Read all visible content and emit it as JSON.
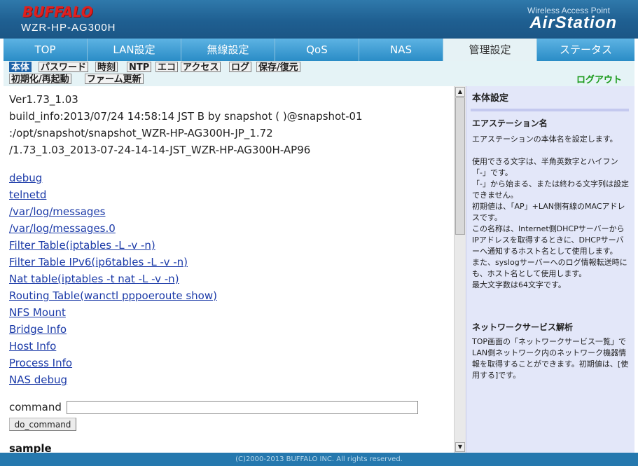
{
  "header": {
    "brand": "BUFFALO",
    "model": "WZR-HP-AG300H",
    "product_sub": "Wireless Access Point",
    "product": "AirStation"
  },
  "tabs": [
    {
      "label": "TOP"
    },
    {
      "label": "LAN設定"
    },
    {
      "label": "無線設定"
    },
    {
      "label": "QoS"
    },
    {
      "label": "NAS"
    },
    {
      "label": "管理設定"
    },
    {
      "label": "ステータス"
    }
  ],
  "active_tab": "管理設定",
  "subtabs": [
    {
      "label": "本体"
    },
    {
      "label": "パスワード"
    },
    {
      "label": "時刻"
    },
    {
      "label": "NTP"
    },
    {
      "label": "エコ"
    },
    {
      "label": "アクセス"
    },
    {
      "label": "ログ"
    },
    {
      "label": "保存/復元"
    },
    {
      "label": "初期化/再起動"
    },
    {
      "label": "ファーム更新"
    }
  ],
  "active_subtab": "本体",
  "logout": "ログアウト",
  "content": {
    "version_lines": [
      "Ver1.73_1.03",
      "build_info:2013/07/24 14:58:14 JST B by snapshot ( )@snapshot-01",
      ":/opt/snapshot/snapshot_WZR-HP-AG300H-JP_1.72",
      "/1.73_1.03_2013-07-24-14-14-JST_WZR-HP-AG300H-AP96"
    ],
    "links": [
      "debug",
      "telnetd",
      "/var/log/messages",
      "/var/log/messages.0",
      "Filter Table(iptables -L -v -n)",
      "Filter Table IPv6(ip6tables -L -v -n)",
      "Nat table(iptables -t nat -L -v -n)",
      "Routing Table(wanctl pppoeroute show)",
      "NFS Mount",
      "Bridge Info",
      "Host Info",
      "Process Info",
      "NAS debug"
    ],
    "command_label": "command",
    "command_value": "",
    "do_command_label": "do_command",
    "sample_heading": "sample"
  },
  "help": {
    "title": "本体設定",
    "section1_title": "エアステーション名",
    "section1_p1": "エアステーションの本体名を設定します。",
    "section1_p2": "使用できる文字は、半角英数字とハイフン「-」です。\n「-」から始まる、または終わる文字列は設定できません。\n初期値は、「AP」+LAN側有線のMACアドレスです。\nこの名称は、Internet側DHCPサーバーからIPアドレスを取得するときに、DHCPサーバーへ通知するホスト名として使用します。\nまた、syslogサーバーへのログ情報転送時にも、ホスト名として使用します。\n最大文字数は64文字です。",
    "section2_title": "ネットワークサービス解析",
    "section2_p1": "TOP画面の「ネットワークサービス一覧」でLAN側ネットワーク内のネットワーク機器情報を取得することができます。初期値は、[使用する]です。"
  },
  "footer": "(C)2000-2013 BUFFALO INC. All rights reserved."
}
